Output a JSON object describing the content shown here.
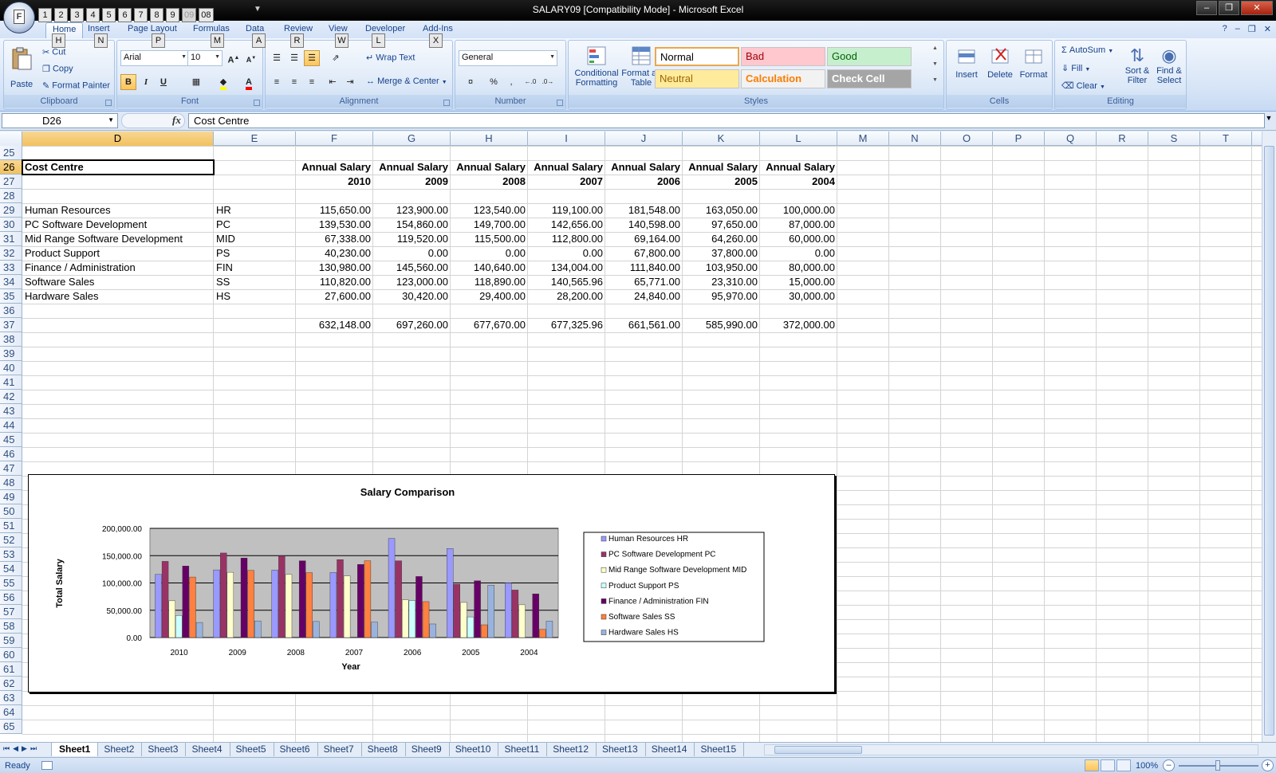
{
  "window": {
    "title": "SALARY09  [Compatibility Mode] - Microsoft Excel",
    "office_button_keytip": "F",
    "qat_keytips": [
      "1",
      "2",
      "3",
      "4",
      "5",
      "6",
      "7",
      "8",
      "9",
      "09",
      "08"
    ]
  },
  "ribbon": {
    "tabs": [
      {
        "label": "Home",
        "keytip": "H"
      },
      {
        "label": "Insert",
        "keytip": "N"
      },
      {
        "label": "Page Layout",
        "keytip": "P"
      },
      {
        "label": "Formulas",
        "keytip": "M"
      },
      {
        "label": "Data",
        "keytip": "A"
      },
      {
        "label": "Review",
        "keytip": "R"
      },
      {
        "label": "View",
        "keytip": "W"
      },
      {
        "label": "Developer",
        "keytip": "L"
      },
      {
        "label": "Add-Ins",
        "keytip": "X"
      }
    ],
    "clipboard": {
      "label": "Clipboard",
      "paste": "Paste",
      "cut": "Cut",
      "copy": "Copy",
      "format_painter": "Format Painter"
    },
    "font": {
      "label": "Font",
      "font_name": "Arial",
      "font_size": "10",
      "bold": "B",
      "italic": "I",
      "underline": "U"
    },
    "alignment": {
      "label": "Alignment",
      "wrap_text": "Wrap Text",
      "merge_center": "Merge & Center"
    },
    "number": {
      "label": "Number",
      "format": "General",
      "percent": "%"
    },
    "styles": {
      "label": "Styles",
      "conditional_formatting": [
        "Conditional",
        "Formatting"
      ],
      "format_as_table": [
        "Format as",
        "Table"
      ],
      "cells": [
        {
          "name": "Normal",
          "bg": "#ffffff",
          "fg": "#000000"
        },
        {
          "name": "Bad",
          "bg": "#ffc7ce",
          "fg": "#9c0006"
        },
        {
          "name": "Good",
          "bg": "#c6efce",
          "fg": "#006100"
        },
        {
          "name": "Neutral",
          "bg": "#ffeb9c",
          "fg": "#9c6500"
        },
        {
          "name": "Calculation",
          "bg": "#f2f2f2",
          "fg": "#fa7d00"
        },
        {
          "name": "Check Cell",
          "bg": "#a5a5a5",
          "fg": "#ffffff"
        }
      ]
    },
    "cells_group": {
      "label": "Cells",
      "insert": "Insert",
      "delete": "Delete",
      "format": "Format"
    },
    "editing": {
      "label": "Editing",
      "autosum": "AutoSum",
      "fill": "Fill",
      "clear": "Clear",
      "sort_filter": [
        "Sort &",
        "Filter"
      ],
      "find_select": [
        "Find &",
        "Select"
      ]
    }
  },
  "formula_bar": {
    "name_box": "D26",
    "fx": "fx",
    "content": "Cost Centre"
  },
  "grid": {
    "columns": [
      "D",
      "E",
      "F",
      "G",
      "H",
      "I",
      "J",
      "K",
      "L",
      "M",
      "N",
      "O",
      "P",
      "Q",
      "R",
      "S",
      "T"
    ],
    "selected_column": "D",
    "rows": [
      "25",
      "26",
      "27",
      "28",
      "29",
      "30",
      "31",
      "32",
      "33",
      "34",
      "35",
      "36",
      "37",
      "38",
      "39",
      "40",
      "41",
      "42",
      "43",
      "44",
      "45",
      "46",
      "47",
      "48",
      "49",
      "50",
      "51",
      "52",
      "53",
      "54",
      "55",
      "56",
      "57",
      "58",
      "59",
      "60",
      "61",
      "62",
      "63",
      "64",
      "65"
    ],
    "selected_row": "26",
    "header_label": "Cost Centre",
    "year_headers": [
      {
        "label": "Annual Salary",
        "year": "2010"
      },
      {
        "label": "Annual Salary",
        "year": "2009"
      },
      {
        "label": "Annual Salary",
        "year": "2008"
      },
      {
        "label": "Annual Salary",
        "year": "2007"
      },
      {
        "label": "Annual Salary",
        "year": "2006"
      },
      {
        "label": "Annual Salary",
        "year": "2005"
      },
      {
        "label": "Annual Salary",
        "year": "2004"
      }
    ],
    "data_rows": [
      {
        "name": "Human Resources",
        "code": "HR",
        "values": [
          "115,650.00",
          "123,900.00",
          "123,540.00",
          "119,100.00",
          "181,548.00",
          "163,050.00",
          "100,000.00"
        ]
      },
      {
        "name": "PC Software Development",
        "code": "PC",
        "values": [
          "139,530.00",
          "154,860.00",
          "149,700.00",
          "142,656.00",
          "140,598.00",
          "97,650.00",
          "87,000.00"
        ]
      },
      {
        "name": "Mid Range Software Development",
        "code": "MID",
        "values": [
          "67,338.00",
          "119,520.00",
          "115,500.00",
          "112,800.00",
          "69,164.00",
          "64,260.00",
          "60,000.00"
        ]
      },
      {
        "name": "Product Support",
        "code": "PS",
        "values": [
          "40,230.00",
          "0.00",
          "0.00",
          "0.00",
          "67,800.00",
          "37,800.00",
          "0.00"
        ]
      },
      {
        "name": "Finance / Administration",
        "code": "FIN",
        "values": [
          "130,980.00",
          "145,560.00",
          "140,640.00",
          "134,004.00",
          "111,840.00",
          "103,950.00",
          "80,000.00"
        ]
      },
      {
        "name": "Software Sales",
        "code": "SS",
        "values": [
          "110,820.00",
          "123,000.00",
          "118,890.00",
          "140,565.96",
          "65,771.00",
          "23,310.00",
          "15,000.00"
        ]
      },
      {
        "name": "Hardware Sales",
        "code": "HS",
        "values": [
          "27,600.00",
          "30,420.00",
          "29,400.00",
          "28,200.00",
          "24,840.00",
          "95,970.00",
          "30,000.00"
        ]
      }
    ],
    "totals": [
      "632,148.00",
      "697,260.00",
      "677,670.00",
      "677,325.96",
      "661,561.00",
      "585,990.00",
      "372,000.00"
    ]
  },
  "chart_data": {
    "type": "bar",
    "title": "Salary Comparison",
    "xlabel": "Year",
    "ylabel": "Total Salary",
    "categories": [
      "2010",
      "2009",
      "2008",
      "2007",
      "2006",
      "2005",
      "2004"
    ],
    "ylim": [
      0,
      200000
    ],
    "y_ticks": [
      "200,000.00",
      "150,000.00",
      "100,000.00",
      "50,000.00",
      "0.00"
    ],
    "grid": true,
    "legend_position": "right",
    "series": [
      {
        "name": "Human Resources HR",
        "color": "#9999ff",
        "values": [
          115650,
          123900,
          123540,
          119100,
          181548,
          163050,
          100000
        ]
      },
      {
        "name": "PC Software Development PC",
        "color": "#993366",
        "values": [
          139530,
          154860,
          149700,
          142656,
          140598,
          97650,
          87000
        ]
      },
      {
        "name": "Mid Range Software Development MID",
        "color": "#ffffcc",
        "values": [
          67338,
          119520,
          115500,
          112800,
          69164,
          64260,
          60000
        ]
      },
      {
        "name": "Product Support PS",
        "color": "#ccffff",
        "values": [
          40230,
          0,
          0,
          0,
          67800,
          37800,
          0
        ]
      },
      {
        "name": "Finance / Administration FIN",
        "color": "#660066",
        "values": [
          130980,
          145560,
          140640,
          134004,
          111840,
          103950,
          80000
        ]
      },
      {
        "name": "Software Sales SS",
        "color": "#ff8040",
        "values": [
          110820,
          123000,
          118890,
          140565.96,
          65771,
          23310,
          15000
        ]
      },
      {
        "name": "Hardware Sales HS",
        "color": "#99b3dd",
        "values": [
          27600,
          30420,
          29400,
          28200,
          24840,
          95970,
          30000
        ]
      }
    ]
  },
  "sheets": {
    "tabs": [
      "Sheet1",
      "Sheet2",
      "Sheet3",
      "Sheet4",
      "Sheet5",
      "Sheet6",
      "Sheet7",
      "Sheet8",
      "Sheet9",
      "Sheet10",
      "Sheet11",
      "Sheet12",
      "Sheet13",
      "Sheet14",
      "Sheet15"
    ],
    "active": "Sheet1"
  },
  "status": {
    "text": "Ready",
    "zoom": "100%"
  }
}
